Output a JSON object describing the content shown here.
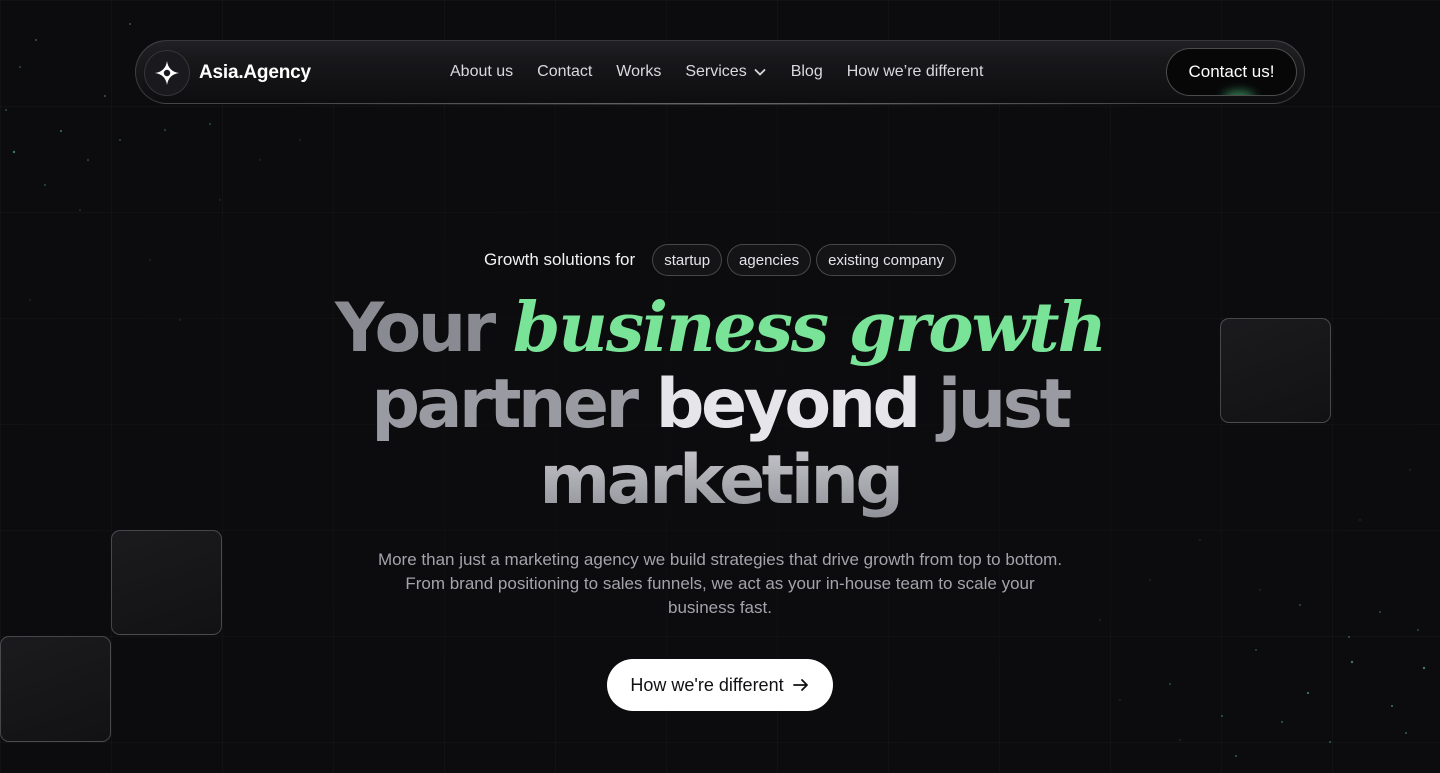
{
  "brand": {
    "name": "Asia.Agency",
    "logo_icon": "sparkle-star-icon"
  },
  "nav": {
    "items": [
      {
        "label": "About us"
      },
      {
        "label": "Contact"
      },
      {
        "label": "Works"
      },
      {
        "label": "Services",
        "icon": "chevron-down-icon"
      },
      {
        "label": "Blog"
      },
      {
        "label": "How we’re different"
      }
    ],
    "cta_label": "Contact us!"
  },
  "hero": {
    "tagline": "Growth solutions for",
    "pills": [
      "startup",
      "agencies",
      "existing company"
    ],
    "headline": {
      "w1": "Your",
      "accent": "business growth",
      "w2": "partner",
      "w3": "beyond",
      "w4": "just",
      "w5": "marketing"
    },
    "subtitle": "More than just a marketing agency we build strategies that drive growth from top to bottom. From brand positioning to sales funnels, we act as your in-house team to scale your business fast.",
    "cta_label": "How we're different",
    "cta_icon": "arrow-right-icon"
  },
  "colors": {
    "background": "#0c0c0e",
    "accent_green": "#79e398",
    "text_primary": "#e6e6ea",
    "text_muted": "#a3a3ab"
  }
}
